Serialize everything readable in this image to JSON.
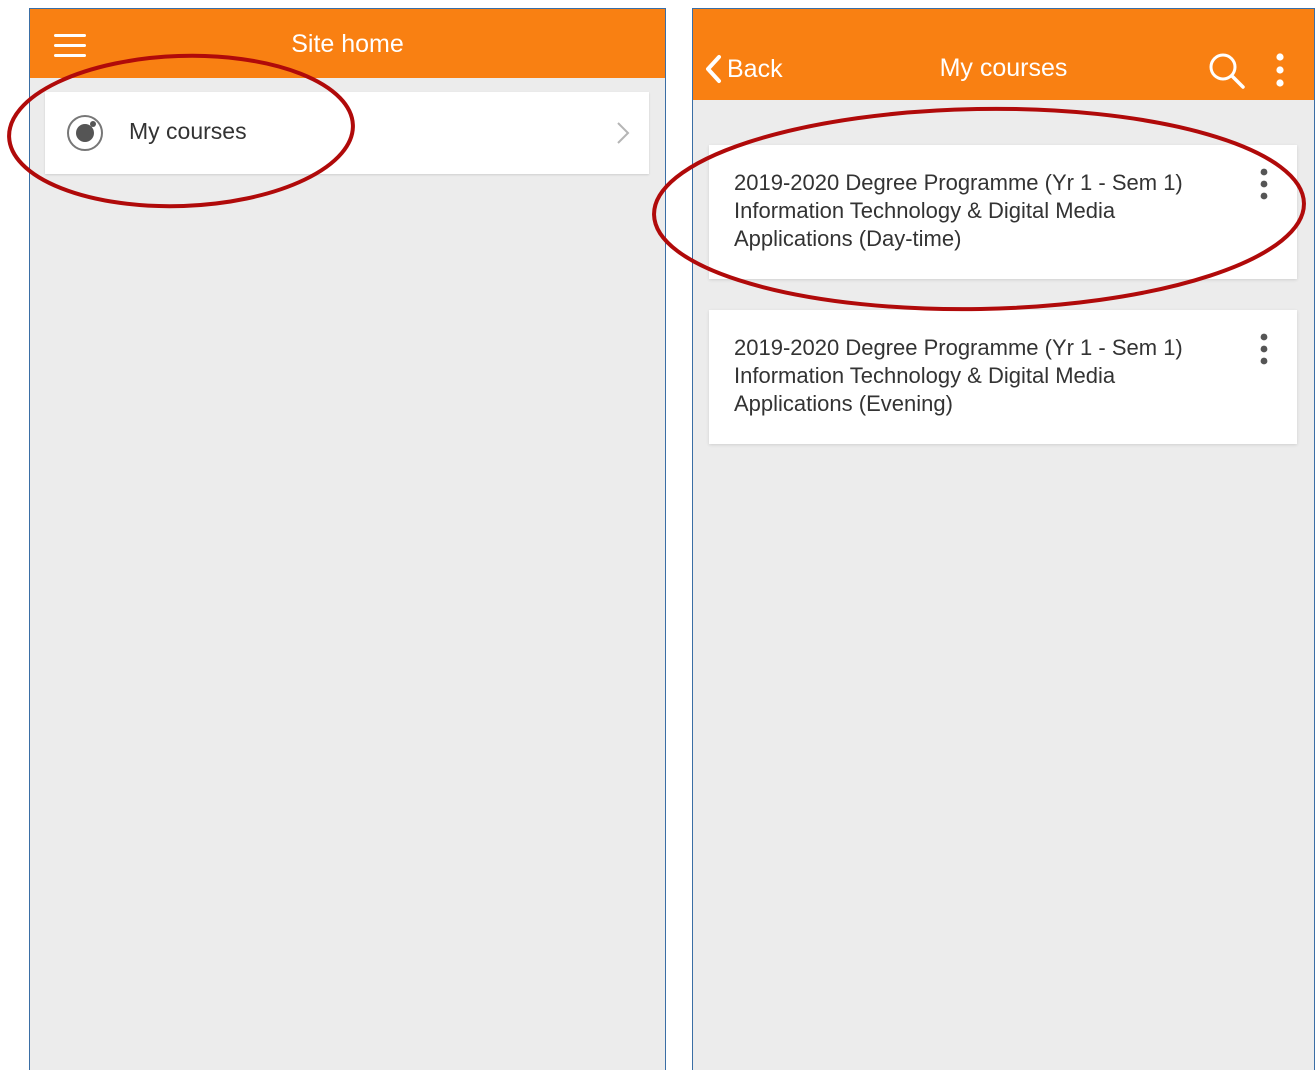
{
  "colors": {
    "appbar": "#f98012",
    "background": "#ececec",
    "card": "#ffffff",
    "text": "#333333",
    "annotation": "#b00a0a"
  },
  "left_screen": {
    "header": {
      "title": "Site home",
      "menu_icon": "hamburger-icon"
    },
    "link": {
      "label": "My courses",
      "icon": "radio-target-icon",
      "chevron": "chevron-right-icon"
    }
  },
  "right_screen": {
    "header": {
      "back_label": "Back",
      "title": "My courses",
      "search_icon": "search-icon",
      "more_icon": "more-vertical-icon"
    },
    "courses": [
      {
        "title": "2019-2020 Degree Programme (Yr 1 - Sem 1) Information Technology & Digital Media Applications (Day-time)"
      },
      {
        "title": "2019-2020 Degree Programme (Yr 1 - Sem 1) Information Technology & Digital Media Applications (Evening)"
      }
    ]
  }
}
